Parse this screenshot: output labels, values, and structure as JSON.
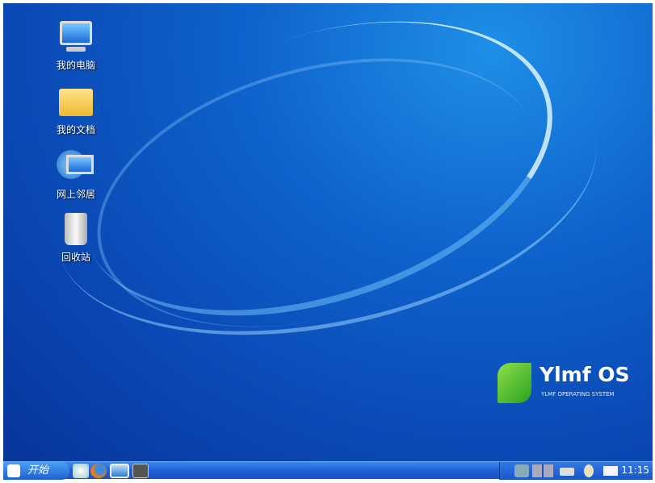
{
  "desktop_icons": [
    {
      "label": "我的电脑",
      "icon": "computer-icon"
    },
    {
      "label": "我的文档",
      "icon": "folder-icon"
    },
    {
      "label": "网上邻居",
      "icon": "network-icon"
    },
    {
      "label": "回收站",
      "icon": "recycle-bin-icon"
    }
  ],
  "logo": {
    "title": "Ylmf OS",
    "subtitle": "YLMF OPERATING SYSTEM"
  },
  "taskbar": {
    "start_label": "开始",
    "clock": "11:15"
  },
  "colors": {
    "desktop": "#0f63cc",
    "taskbar": "#1f5fd6",
    "logo_green": "#3cbf2a"
  }
}
